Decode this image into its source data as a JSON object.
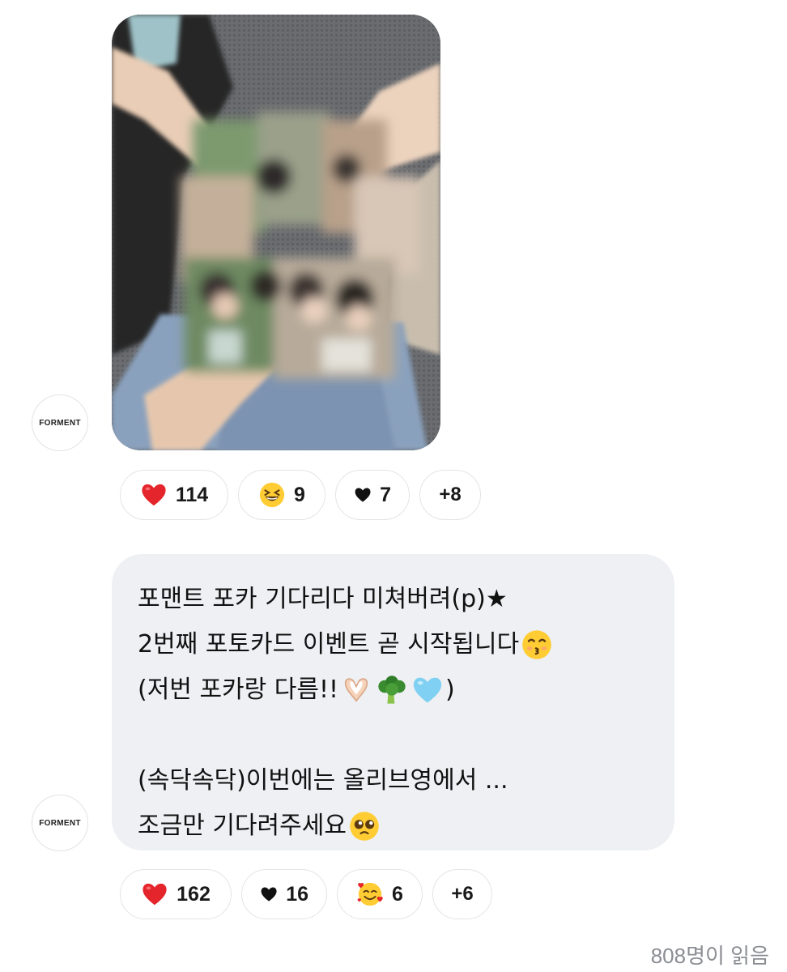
{
  "chat": {
    "sender_avatar_label": "FORMENT",
    "messages": [
      {
        "type": "photo",
        "reactions": [
          {
            "icon": "red-heart-icon",
            "count": "114"
          },
          {
            "icon": "grinning-squinting-face-icon",
            "count": "9"
          },
          {
            "icon": "black-heart-icon",
            "count": "7"
          }
        ],
        "more_reactions": "+8"
      },
      {
        "type": "text",
        "lines": {
          "l1": "포맨트 포카 기다리다 미쳐버려(p)★",
          "l2": "2번째 포토카드 이벤트 곧 시작됩니다",
          "l3a": "(저번 포카랑 다름!!",
          "l3b": ")",
          "l5": "(속닥속닥)이번에는 올리브영에서 ...",
          "l6": "조금만 기다려주세요"
        },
        "inline_emojis": [
          "kissing-face-icon",
          "heart-hands-icon",
          "broccoli-icon",
          "light-blue-heart-icon",
          "pleading-face-icon"
        ],
        "reactions": [
          {
            "icon": "red-heart-icon",
            "count": "162"
          },
          {
            "icon": "black-heart-icon",
            "count": "16"
          },
          {
            "icon": "smiling-face-with-hearts-icon",
            "count": "6"
          }
        ],
        "more_reactions": "+6"
      }
    ],
    "read_receipt": "808명이 읽음"
  },
  "colors": {
    "bubble_bg": "#eef0f3",
    "pill_border": "#e2e4e8",
    "receipt_text": "#8a8d92"
  }
}
